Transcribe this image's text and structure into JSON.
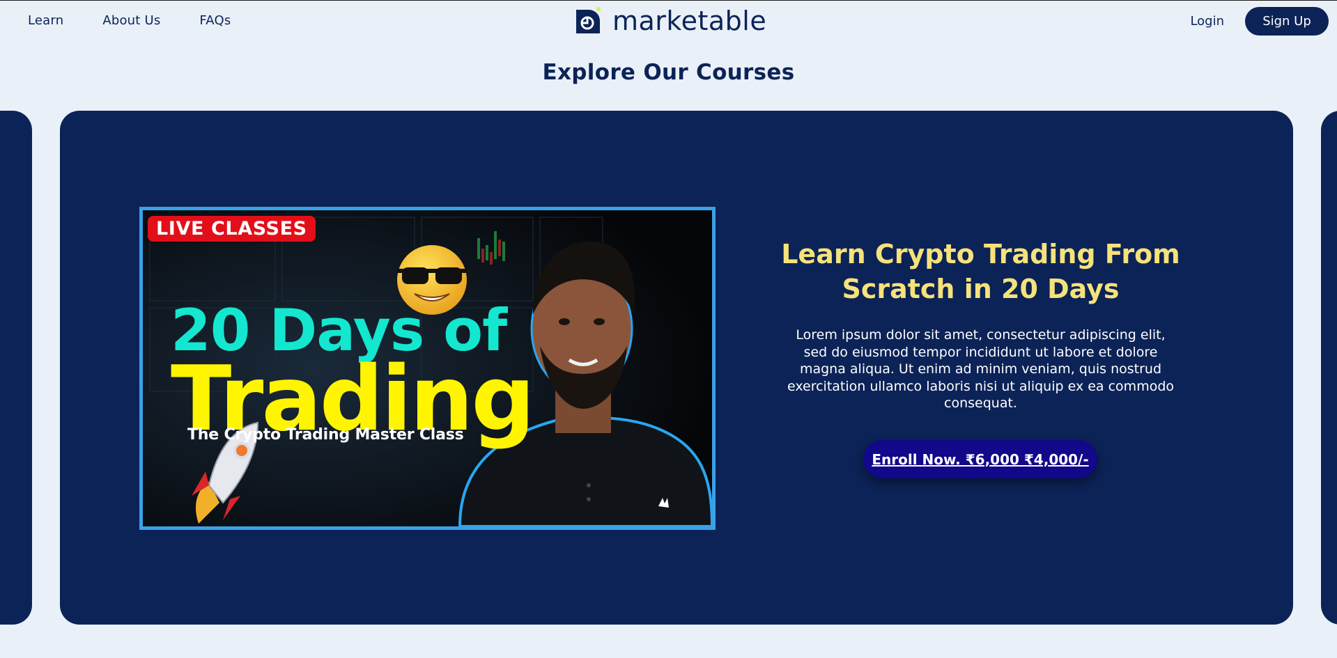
{
  "header": {
    "nav_left": [
      {
        "label": "Learn"
      },
      {
        "label": "About Us"
      },
      {
        "label": "FAQs"
      }
    ],
    "logo_text": "marketable",
    "login_label": "Login",
    "signup_label": "Sign Up"
  },
  "main": {
    "section_title": "Explore Our Courses",
    "course": {
      "thumbnail": {
        "badge": "LIVE CLASSES",
        "line1": "20 Days of",
        "line2": "Trading",
        "subtitle": "The Crypto Trading Master Class"
      },
      "title": "Learn Crypto Trading From Scratch in 20 Days",
      "description": "Lorem ipsum dolor sit amet, consectetur adipiscing elit, sed do eiusmod tempor incididunt ut labore et dolore magna aliqua. Ut enim ad minim veniam, quis nostrud exercitation ullamco laboris nisi ut aliquip ex ea commodo consequat.",
      "enroll_label": "Enroll Now. ₹6,000 ₹4,000/-"
    }
  },
  "colors": {
    "page_bg": "#e9f0f8",
    "navy": "#0c2357",
    "title_yellow": "#f6e27a",
    "button_indigo": "#12088a",
    "thumb_border": "#3aa1e6"
  },
  "icons": [
    "marketable-logo-icon",
    "sunglasses-emoji-icon",
    "rocket-icon"
  ]
}
